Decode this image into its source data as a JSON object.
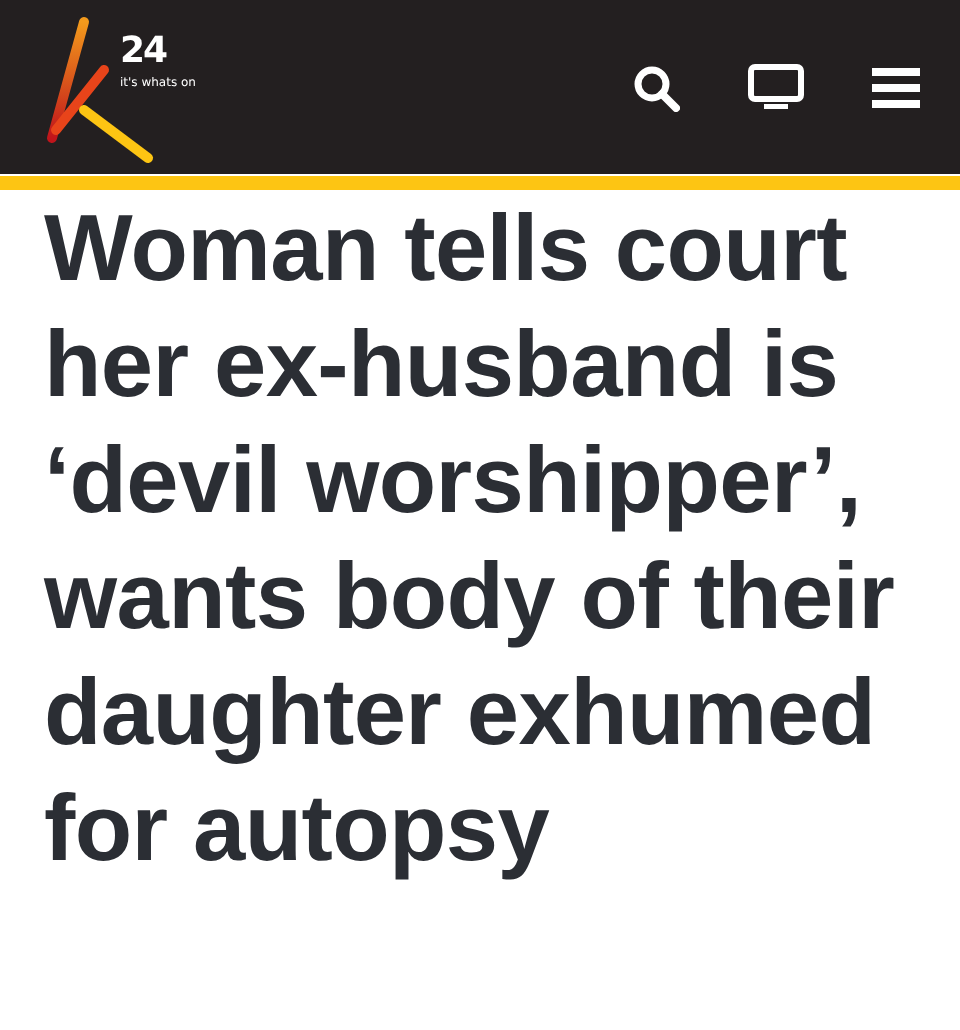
{
  "header": {
    "logo": {
      "number": "24",
      "tagline": "it's whats on"
    }
  },
  "article": {
    "headline": "Woman tells court her ex-husband is ‘devil worshipper’, wants body of their daughter exhumed for autopsy"
  }
}
